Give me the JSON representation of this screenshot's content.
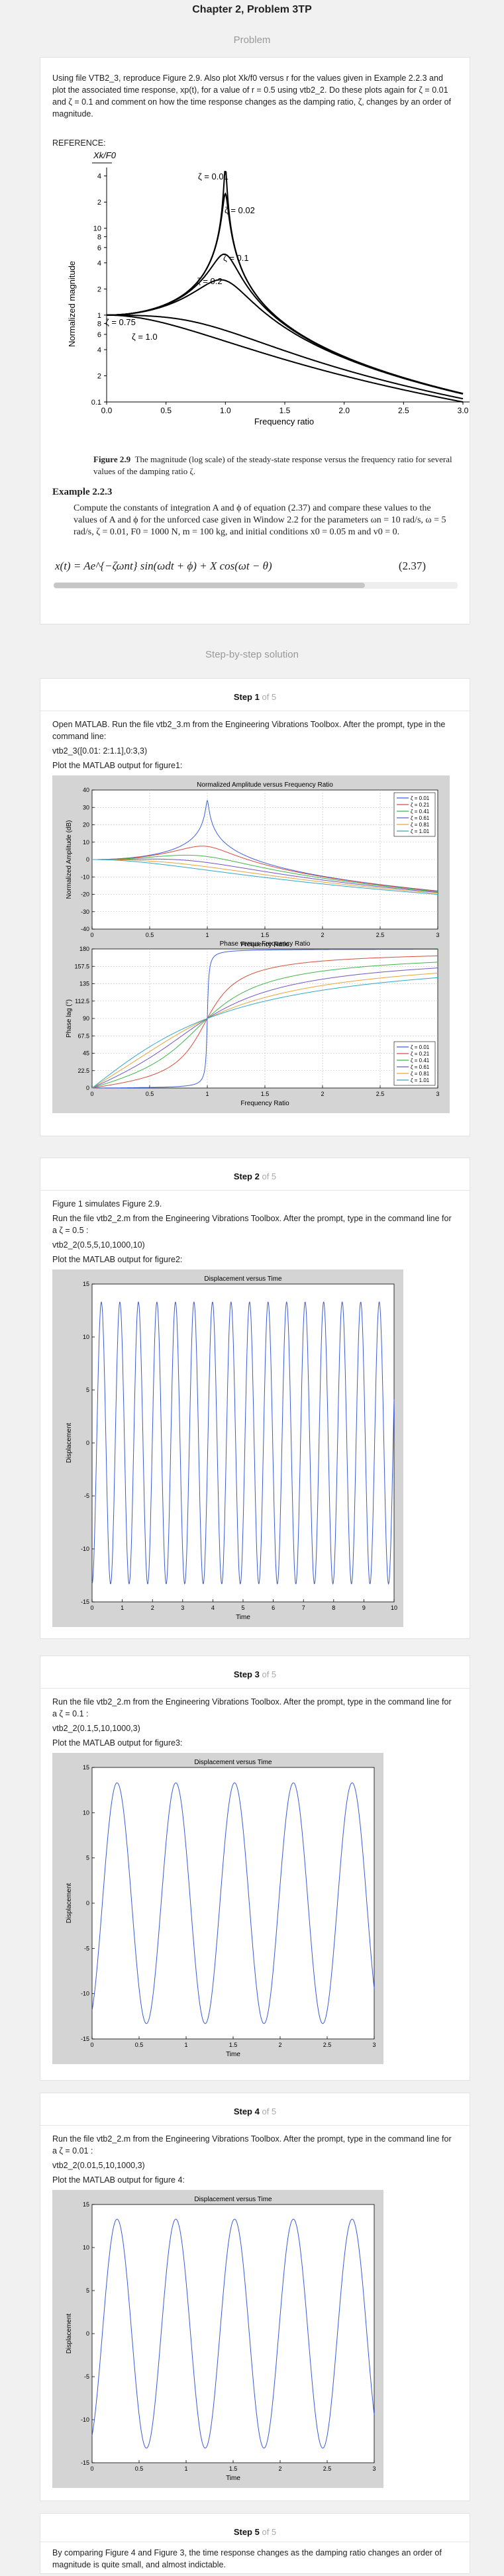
{
  "header": {
    "title": "Chapter 2, Problem 3TP",
    "problem_label": "Problem",
    "solution_label": "Step-by-step solution"
  },
  "problem": {
    "text": "Using file VTB2_3, reproduce Figure 2.9. Also plot Xk/f0 versus r for the values given in Example 2.2.3 and plot the associated time response, xp(t), for a value of r = 0.5 using vtb2_2. Do these plots again for ζ = 0.01 and ζ = 0.1 and comment on how the time response changes as the damping ratio, ζ, changes by an order of magnitude.",
    "reference_label": "REFERENCE:",
    "figure": {
      "ylabel": "Normalized magnitude",
      "xlabel": "Frequency ratio",
      "yaxis_top_label": "Xk/F0",
      "yticks": [
        "4",
        "2",
        "10",
        "8",
        "6",
        "4",
        "2",
        "1",
        "8",
        "6",
        "4",
        "2",
        "0.1"
      ],
      "xticks": [
        "0.0",
        "0.5",
        "1.0",
        "1.5",
        "2.0",
        "2.5",
        "3.0"
      ],
      "curve_labels": [
        "ζ = 0.01",
        "ζ = 0.02",
        "ζ = 0.1",
        "ζ = 0.2",
        "ζ = 0.75",
        "ζ = 1.0"
      ],
      "caption_bold": "Figure 2.9",
      "caption": "The magnitude (log scale) of the steady-state response versus the frequency ratio for several values of the damping ratio ζ."
    },
    "example_title": "Example 2.2.3",
    "example_text": "Compute the constants of integration A and ϕ of equation (2.37) and compare these values to the values of A and ϕ for the unforced case given in Window 2.2 for the parameters ωn = 10 rad/s, ω = 5 rad/s, ζ = 0.01, F0 = 1000 N, m = 100 kg, and initial conditions x0 = 0.05 m and v0 = 0.",
    "equation": "x(t) = Ae^{−ζωnt} sin(ωdt + ϕ) + X cos(ωt − θ)",
    "equation_number": "(2.37)"
  },
  "steps": [
    {
      "label": "Step 1",
      "of": "of 5",
      "lines": [
        "Open MATLAB. Run the file vtb2_3.m from the Engineering Vibrations Toolbox. After the prompt, type in the command line:",
        "vtb2_3([0.01: 2:1.1],0:3,3)",
        "Plot the MATLAB output for figure1:"
      ],
      "amp_plot": {
        "title": "Normalized Amplitude versus Frequency Ratio",
        "xlabel": "Frequency Ratio",
        "ylabel": "Normalized Amplitude (dB)",
        "yticks": [
          "40",
          "30",
          "20",
          "10",
          "0",
          "-10",
          "-20",
          "-30",
          "-40"
        ],
        "xticks": [
          "0",
          "0.5",
          "1",
          "1.5",
          "2",
          "2.5",
          "3"
        ],
        "legend": [
          "ζ = 0.01",
          "ζ = 0.21",
          "ζ = 0.41",
          "ζ = 0.61",
          "ζ = 0.81",
          "ζ = 1.01"
        ]
      },
      "phase_plot": {
        "title": "Phase versus Frequency Ratio",
        "xlabel": "Frequency Ratio",
        "ylabel": "Phase lag (°)",
        "yticks": [
          "180",
          "157.5",
          "135",
          "112.5",
          "90",
          "67.5",
          "45",
          "22.5",
          "0"
        ],
        "xticks": [
          "0",
          "0.5",
          "1",
          "1.5",
          "2",
          "2.5",
          "3"
        ],
        "legend": [
          "ζ = 0.01",
          "ζ = 0.21",
          "ζ = 0.41",
          "ζ = 0.61",
          "ζ = 0.81",
          "ζ = 1.01"
        ]
      }
    },
    {
      "label": "Step 2",
      "of": "of 5",
      "lines": [
        "Figure 1 simulates Figure 2.9.",
        "Run the file vtb2_2.m from the Engineering Vibrations Toolbox. After the prompt, type in the command line for a  ζ = 0.5 :",
        "vtb2_2(0.5,5,10,1000,10)",
        "Plot the MATLAB output for figure2:"
      ],
      "plot": {
        "title": "Displacement versus Time",
        "xlabel": "Time",
        "ylabel": "Displacement",
        "yticks": [
          "15",
          "10",
          "5",
          "0",
          "-5",
          "-10",
          "-15"
        ],
        "xticks": [
          "0",
          "1",
          "2",
          "3",
          "4",
          "5",
          "6",
          "7",
          "8",
          "9",
          "10"
        ]
      }
    },
    {
      "label": "Step 3",
      "of": "of 5",
      "lines": [
        "Run the file vtb2_2.m from the Engineering Vibrations Toolbox. After the prompt, type in the command line for a  ζ = 0.1 :",
        "vtb2_2(0.1,5,10,1000,3)",
        "Plot the MATLAB output for figure3:"
      ],
      "plot": {
        "title": "Displacement versus Time",
        "xlabel": "Time",
        "ylabel": "Displacement",
        "yticks": [
          "15",
          "10",
          "5",
          "0",
          "-5",
          "-10",
          "-15"
        ],
        "xticks": [
          "0",
          "0.5",
          "1",
          "1.5",
          "2",
          "2.5",
          "3"
        ]
      }
    },
    {
      "label": "Step 4",
      "of": "of 5",
      "lines": [
        "Run the file vtb2_2.m from the Engineering Vibrations Toolbox. After the prompt, type in the command line for a  ζ = 0.01 :",
        "vtb2_2(0.01,5,10,1000,3)",
        "Plot the MATLAB output for figure 4:"
      ],
      "plot": {
        "title": "Displacement versus Time",
        "xlabel": "Time",
        "ylabel": "Displacement",
        "yticks": [
          "15",
          "10",
          "5",
          "0",
          "-5",
          "-10",
          "-15"
        ],
        "xticks": [
          "0",
          "0.5",
          "1",
          "1.5",
          "2",
          "2.5",
          "3"
        ]
      }
    },
    {
      "label": "Step 5",
      "of": "of 5",
      "lines": [
        "By comparing Figure 4 and Figure 3, the time response changes as the damping ratio changes an order of magnitude is quite small, and almost indictable."
      ]
    }
  ],
  "colors": {
    "matlab_blue": "#3a5ad9",
    "curves": [
      "#3f5fe0",
      "#d94b3a",
      "#3db54a",
      "#6e55c7",
      "#e6a33a",
      "#2fa7c9"
    ]
  }
}
